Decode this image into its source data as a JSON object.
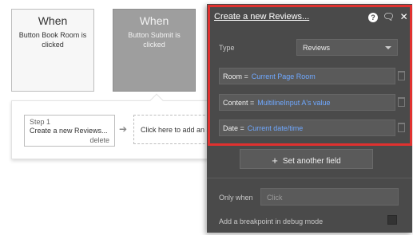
{
  "events": [
    {
      "when": "When",
      "description": "Button Book Room is clicked"
    },
    {
      "when": "When",
      "description": "Button Submit is clicked"
    }
  ],
  "workflow": {
    "step_label": "Step 1",
    "step_action": "Create a new Reviews...",
    "delete_label": "delete",
    "add_action_label": "Click here to add an action..."
  },
  "panel": {
    "title": "Create a new Reviews...",
    "type_label": "Type",
    "type_value": "Reviews",
    "fields": [
      {
        "name": "Room =",
        "value": "Current Page Room"
      },
      {
        "name": "Content =",
        "value": "MultilineInput A's value"
      },
      {
        "name": "Date =",
        "value": "Current date/time"
      }
    ],
    "set_field_label": "Set another field",
    "only_when_label": "Only when",
    "only_when_placeholder": "Click",
    "breakpoint_label": "Add a breakpoint in debug mode",
    "highlight_color": "#e0312f",
    "link_color": "#6fa8ff"
  },
  "icons": {
    "help": "help-icon",
    "comment": "comment-icon",
    "close": "close-icon",
    "trash": "trash-icon",
    "arrow": "arrow-right-icon",
    "plus": "plus-icon"
  }
}
